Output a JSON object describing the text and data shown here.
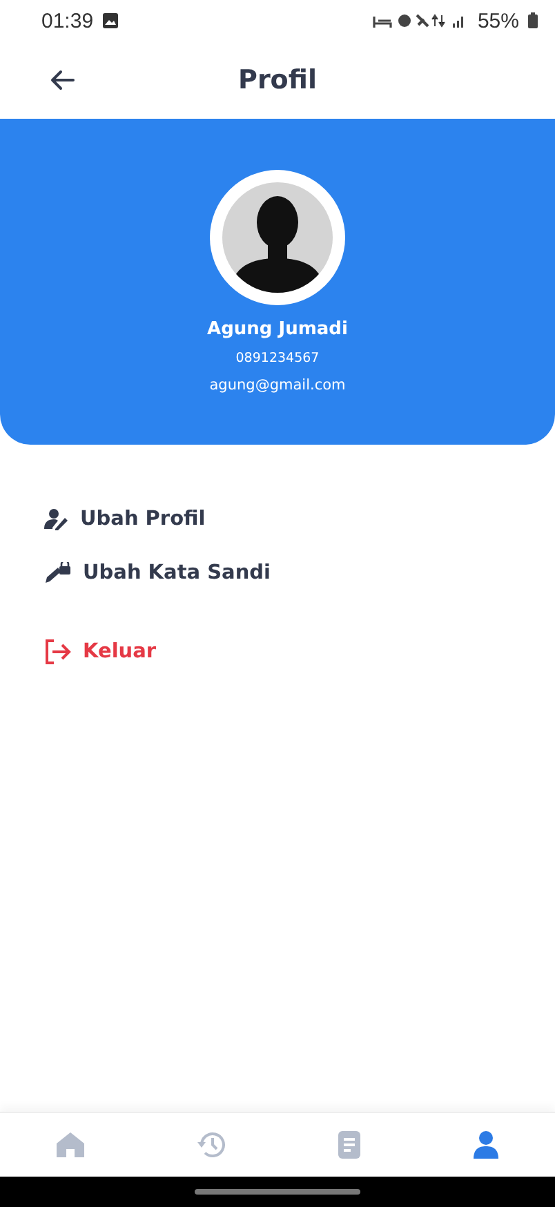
{
  "status_bar": {
    "time": "01:39",
    "battery": "55%"
  },
  "header": {
    "title": "Profil"
  },
  "profile": {
    "name": "Agung Jumadi",
    "phone": "0891234567",
    "email": "agung@gmail.com"
  },
  "menu": [
    {
      "label": "Ubah Profil",
      "kind": "edit"
    },
    {
      "label": "Ubah Kata Sandi",
      "kind": "password"
    },
    {
      "label": "Keluar",
      "kind": "logout"
    }
  ],
  "nav": [
    {
      "kind": "home",
      "selected": false
    },
    {
      "kind": "history",
      "selected": false
    },
    {
      "kind": "document",
      "selected": false
    },
    {
      "kind": "profile",
      "selected": true
    }
  ]
}
